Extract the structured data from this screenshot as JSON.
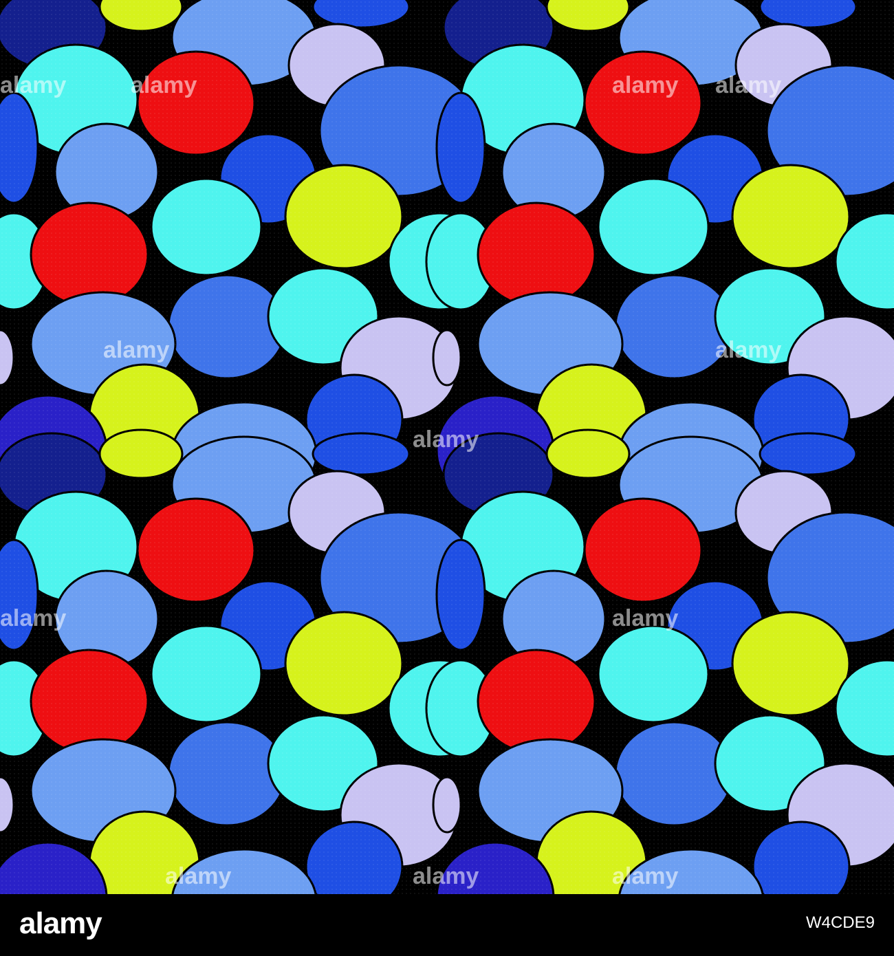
{
  "palette": {
    "red": "#ee0f12",
    "yellow": "#d6f21c",
    "cyan": "#4ff4ee",
    "lavender": "#c9c3f2",
    "light_blue": "#6d9ff2",
    "mid_blue": "#3f74ea",
    "royal_blue": "#1f4fe4",
    "indigo": "#2a21c8",
    "navy": "#14208e",
    "outline": "#000000"
  },
  "pattern": {
    "description_icon": "overlapping-circles-pattern"
  },
  "watermark": {
    "text": "alamy"
  },
  "footer": {
    "logo_text": "alamy",
    "image_id": "W4CDE9"
  }
}
